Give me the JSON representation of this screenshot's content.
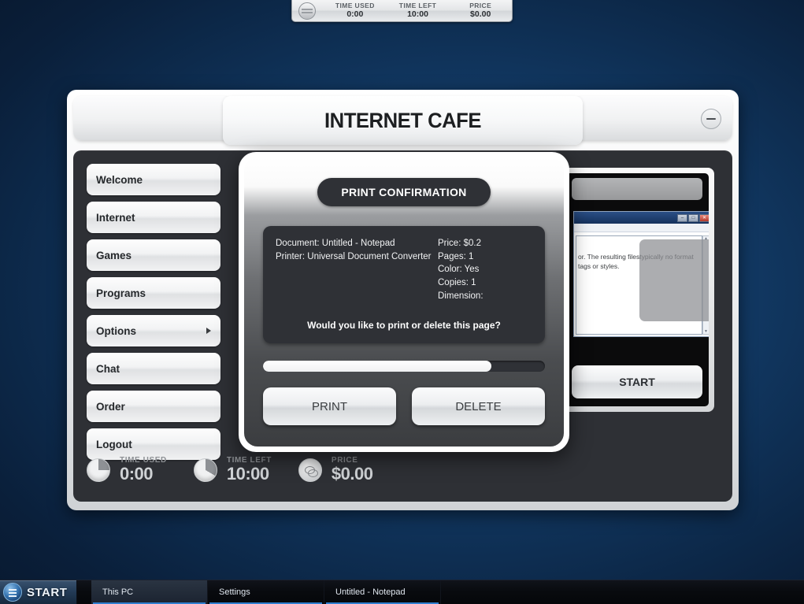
{
  "top_strip": {
    "icon": "clock-disc-icon",
    "blocks": [
      {
        "label": "TIME USED",
        "value": "0:00"
      },
      {
        "label": "TIME LEFT",
        "value": "10:00"
      },
      {
        "label": "PRICE",
        "value": "$0.00"
      }
    ]
  },
  "window": {
    "title": "INTERNET CAFE",
    "minimize_label": "−"
  },
  "sidebar": {
    "items": [
      {
        "label": "Welcome",
        "has_arrow": false
      },
      {
        "label": "Internet",
        "has_arrow": false
      },
      {
        "label": "Games",
        "has_arrow": false
      },
      {
        "label": "Programs",
        "has_arrow": false
      },
      {
        "label": "Options",
        "has_arrow": true
      },
      {
        "label": "Chat",
        "has_arrow": false
      },
      {
        "label": "Order",
        "has_arrow": false
      },
      {
        "label": "Logout",
        "has_arrow": false
      }
    ]
  },
  "preview": {
    "notepad": {
      "minimize_glyph": "–",
      "maximize_glyph": "□",
      "close_glyph": "✕",
      "body_text": "or. The resulting filestypically no format tags or styles."
    },
    "start_label": "START"
  },
  "status_row": [
    {
      "icon": "pie-chart-icon",
      "label": "TIME USED",
      "value": "0:00"
    },
    {
      "icon": "pie-chart-icon",
      "label": "TIME LEFT",
      "value": "10:00"
    },
    {
      "icon": "coins-icon",
      "label": "PRICE",
      "value": "$0.00"
    }
  ],
  "dialog": {
    "title": "PRINT CONFIRMATION",
    "info_left": [
      "Document: Untitled - Notepad",
      "Printer: Universal Document Converter"
    ],
    "info_right": [
      "Price: $0.2",
      "Pages: 1",
      "Color: Yes",
      "Copies: 1",
      "Dimension:"
    ],
    "question": "Would you like to print or delete this page?",
    "progress_percent": 81,
    "print_label": "PRINT",
    "delete_label": "DELETE"
  },
  "taskbar": {
    "start_label": "START",
    "buttons": [
      {
        "label": "This PC",
        "active": true
      },
      {
        "label": "Settings",
        "active": false
      },
      {
        "label": "Untitled - Notepad",
        "active": false
      }
    ]
  },
  "colors": {
    "accent_blue": "#2f7fd0",
    "panel_dark": "#2e3035",
    "dialog_dark": "#2f3136",
    "desktop_blue": "#14406f"
  }
}
